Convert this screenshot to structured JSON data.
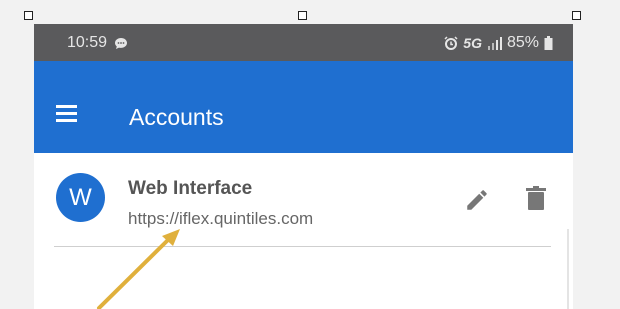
{
  "status_bar": {
    "time": "10:59",
    "network": "5G",
    "battery": "85%",
    "icons": [
      "message-icon",
      "alarm-icon",
      "signal-icon",
      "battery-icon"
    ]
  },
  "app_bar": {
    "title": "Accounts",
    "menu_icon": "hamburger-menu-icon",
    "color": "#1f6fd0"
  },
  "accounts": [
    {
      "avatar_letter": "W",
      "name": "Web Interface",
      "url": "https://iflex.quintiles.com",
      "actions": [
        "edit-icon",
        "delete-icon"
      ]
    }
  ],
  "annotation": {
    "arrow_color": "#e0b03c"
  }
}
